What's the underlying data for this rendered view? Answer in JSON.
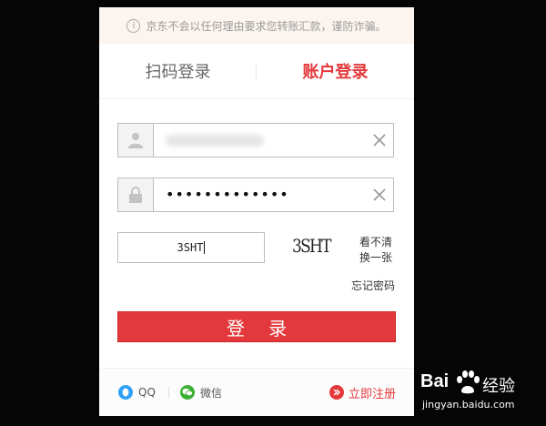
{
  "notice": {
    "text": "京东不会以任何理由要求您转账汇款，谨防诈骗。"
  },
  "tabs": {
    "qr_label": "扫码登录",
    "account_label": "账户登录"
  },
  "username": {
    "value": "",
    "icon": "user-icon"
  },
  "password": {
    "value": "•••••••••••••",
    "icon": "lock-icon"
  },
  "captcha": {
    "input_value": "3SHT",
    "image_text": "3SHT",
    "refresh_line1": "看不清",
    "refresh_line2": "换一张"
  },
  "forgot_label": "忘记密码",
  "login_button_label": "登 录",
  "footer": {
    "qq_label": "QQ",
    "wechat_label": "微信",
    "register_label": "立即注册"
  },
  "watermark": {
    "brand_left": "Bai",
    "brand_right": "经验",
    "url": "jingyan.baidu.com"
  },
  "colors": {
    "accent": "#e4393c",
    "qq": "#2ea1f5",
    "wechat": "#3cb034"
  }
}
